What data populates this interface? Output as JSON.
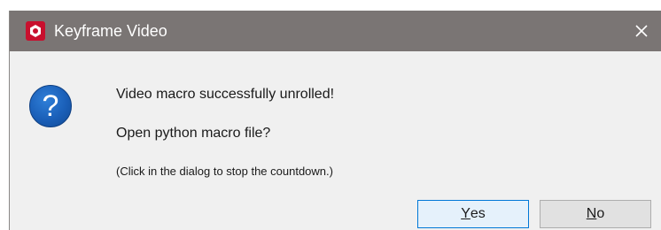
{
  "window": {
    "title": "Keyframe Video",
    "close_glyph": "✕"
  },
  "icons": {
    "app": "app-logo-icon",
    "question": "question-icon",
    "question_glyph": "?"
  },
  "message": {
    "line1": "Video macro successfully unrolled!",
    "line2": "Open python macro file?",
    "hint": "(Click in the dialog to stop the countdown.)"
  },
  "buttons": {
    "yes_mnemonic": "Y",
    "yes_rest": "es",
    "no_mnemonic": "N",
    "no_rest": "o"
  },
  "colors": {
    "titlebar": "#7a7574",
    "app_icon": "#c8102e",
    "question_icon": "#1a5fb8",
    "default_button_border": "#0078d7"
  }
}
